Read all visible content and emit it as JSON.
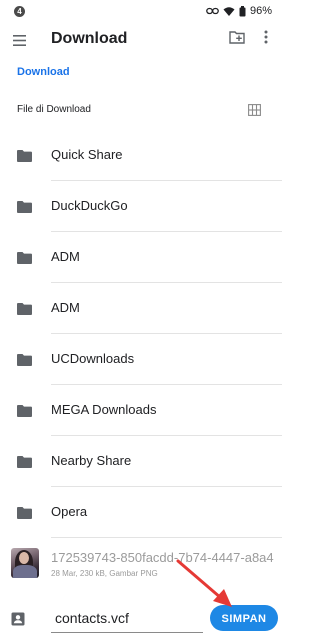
{
  "status_bar": {
    "notification_count": "4",
    "battery_percent": "96%",
    "icons": [
      "notification-badge-icon",
      "link-icon",
      "wifi-icon",
      "battery-icon"
    ]
  },
  "app_bar": {
    "title": "Download",
    "icons": [
      "menu-icon",
      "new-folder-icon",
      "more-vert-icon"
    ]
  },
  "breadcrumb": {
    "label": "Download"
  },
  "section": {
    "title": "File di Download",
    "view_toggle_icon": "grid-view-icon"
  },
  "folders": [
    {
      "name": "Quick Share"
    },
    {
      "name": "DuckDuckGo"
    },
    {
      "name": "ADM"
    },
    {
      "name": "ADM"
    },
    {
      "name": "UCDownloads"
    },
    {
      "name": "MEGA Downloads"
    },
    {
      "name": "Nearby Share"
    },
    {
      "name": "Opera"
    }
  ],
  "file": {
    "name": "172539743-850facdd-7b74-4447-a8a4",
    "meta": "28 Mar, 230 kB, Gambar PNG"
  },
  "save_bar": {
    "filename": "contacts.vcf",
    "save_label": "SIMPAN",
    "icon": "contact-card-icon"
  },
  "colors": {
    "accent": "#1e88e5",
    "breadcrumb": "#1a73e8",
    "annotation_arrow": "#e53935",
    "text_primary": "#202124",
    "text_disabled": "#9b9b9b",
    "folder_icon": "#5f6368"
  }
}
